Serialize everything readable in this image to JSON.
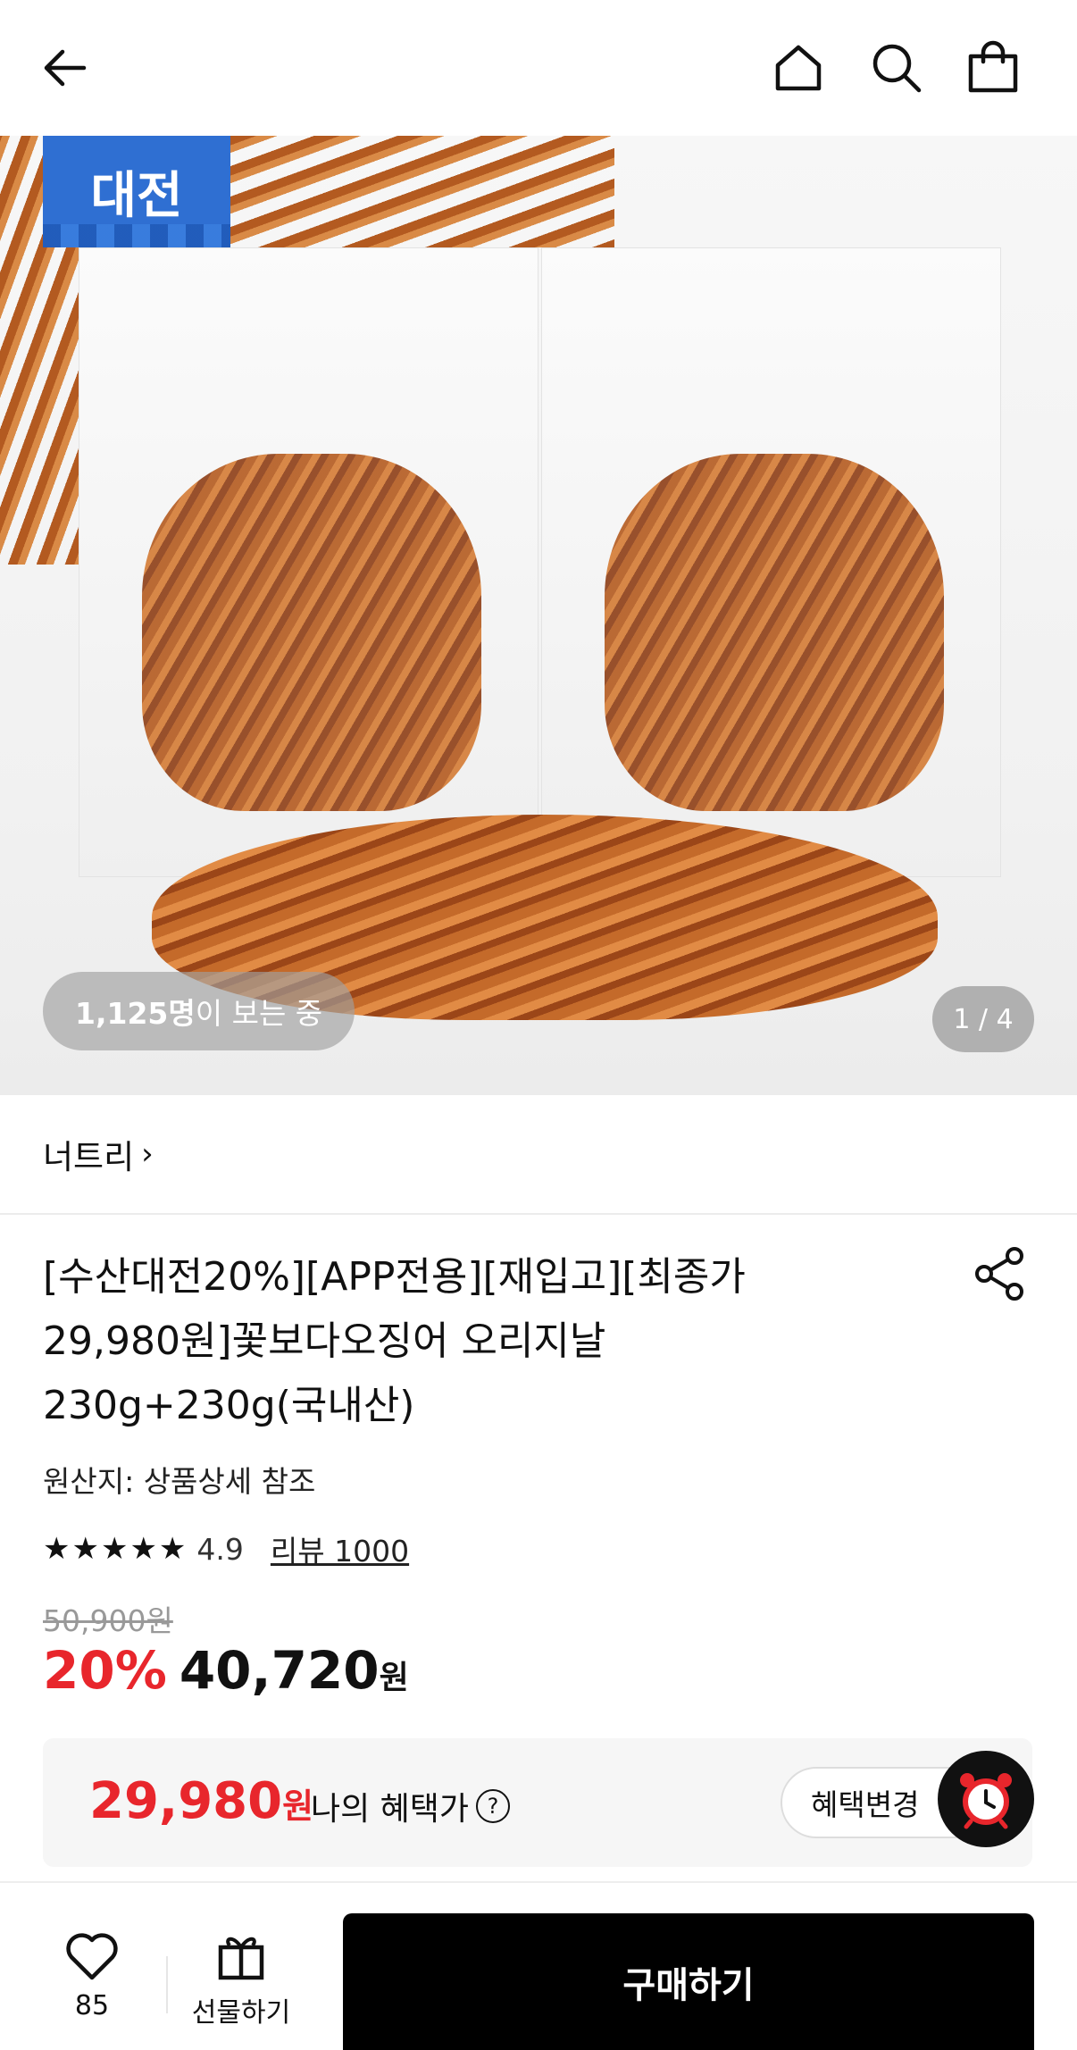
{
  "header": {
    "back_icon": "arrow-left-icon",
    "home_icon": "home-icon",
    "search_icon": "search-icon",
    "bag_icon": "shopping-bag-icon"
  },
  "hero": {
    "badge_text": "대전",
    "viewers_count": "1,125명",
    "viewers_suffix": "이 보는 중",
    "pager": "1 / 4"
  },
  "store": {
    "name": "너트리",
    "chevron": "›"
  },
  "product": {
    "title": "[수산대전20%][APP전용][재입고][최종가 29,980원]꽃보다오징어 오리지날 230g+230g(국내산)",
    "origin": "원산지: 상품상세 참조",
    "stars": "★★★★★",
    "rating_value": 4.9,
    "rating_text": "4.9",
    "review_label": "리뷰 1000",
    "original_price": "50,900원",
    "discount": "20%",
    "sale_price": "40,720",
    "currency": "원"
  },
  "benefit": {
    "price": "29,980",
    "currency": "원",
    "label": "나의 혜택가",
    "help": "?",
    "change_button": "혜택변경"
  },
  "bottom_bar": {
    "like_count": "85",
    "gift_label": "선물하기",
    "buy_label": "구매하기"
  },
  "colors": {
    "accent_red": "#e8262c",
    "badge_blue": "#2f6fd2",
    "buy_bg": "#000000"
  }
}
